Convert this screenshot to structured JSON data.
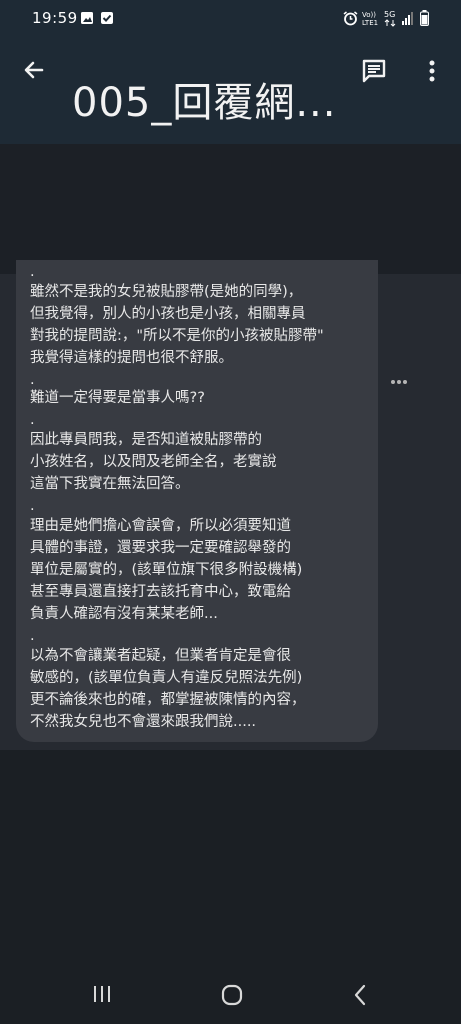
{
  "status_bar": {
    "time": "19:59",
    "icons": [
      "image-notification-icon",
      "check-notification-icon",
      "alarm-icon",
      "volte-icon",
      "5g-icon",
      "signal-icon",
      "battery-icon"
    ]
  },
  "app_bar": {
    "title": "005_回覆網...",
    "icons": [
      "back-arrow-icon",
      "message-icon",
      "more-vert-icon"
    ]
  },
  "message": {
    "paragraphs": [
      ".",
      "雖然不是我的女兒被貼膠帶(是她的同學)，",
      "但我覺得，別人的小孩也是小孩，相關專員",
      "對我的提問說:，\"所以不是你的小孩被貼膠帶\"",
      "我覺得這樣的提問也很不舒服。",
      ".",
      "難道一定得要是當事人嗎??",
      ".",
      "因此專員問我，是否知道被貼膠帶的",
      "小孩姓名，以及問及老師全名，老實說",
      "這當下我實在無法回答。",
      ".",
      "理由是她們擔心會誤會，所以必須要知道",
      "具體的事證，還要求我一定要確認舉發的",
      "單位是屬實的，(該單位旗下很多附設機構)",
      "甚至專員還直接打去該托育中心，致電給",
      "負責人確認有沒有某某老師...",
      ".",
      "以為不會讓業者起疑，但業者肯定是會很",
      "敏感的，(該單位負責人有違反兒照法先例)",
      "更不論後來也的確，都掌握被陳情的內容，",
      "不然我女兒也不會還來跟我們說....."
    ]
  },
  "more_icon": "more-horiz-icon",
  "nav_bar": {
    "icons": [
      "recent-apps-icon",
      "home-icon",
      "back-icon"
    ]
  }
}
